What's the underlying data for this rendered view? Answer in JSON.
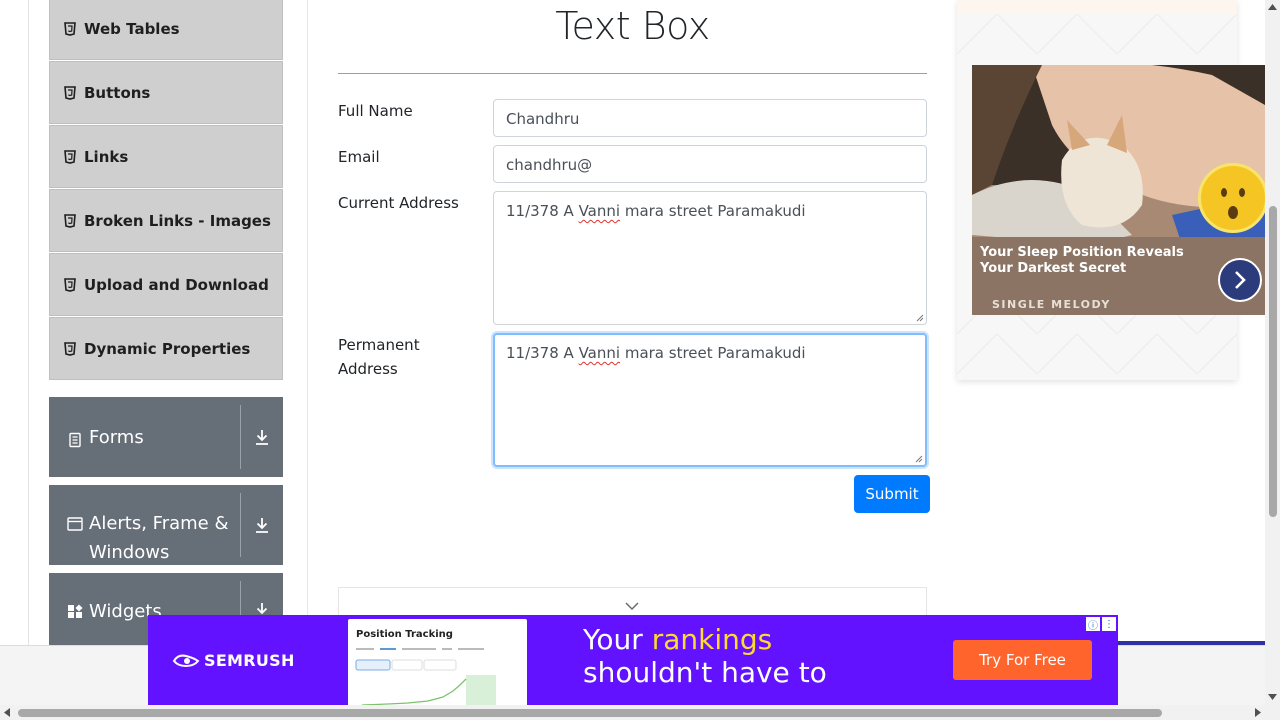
{
  "sidebar": {
    "items": [
      {
        "label": "Web Tables"
      },
      {
        "label": "Buttons"
      },
      {
        "label": "Links"
      },
      {
        "label": "Broken Links - Images"
      },
      {
        "label": "Upload and Download"
      },
      {
        "label": "Dynamic Properties"
      }
    ],
    "groups": [
      {
        "label": "Forms"
      },
      {
        "label": "Alerts, Frame & Windows"
      },
      {
        "label": "Widgets"
      }
    ]
  },
  "main": {
    "title": "Text Box",
    "form": {
      "full_name_label": "Full Name",
      "full_name_value": "Chandhru",
      "email_label": "Email",
      "email_value": "chandhru@",
      "current_address_label": "Current Address",
      "current_address_pre": "11/378 A ",
      "current_address_misspelled": "Vanni",
      "current_address_post": " mara street Paramakudi",
      "permanent_address_label": "Permanent Address",
      "permanent_address_pre": "11/378 A ",
      "permanent_address_misspelled": "Vanni",
      "permanent_address_post": " mara street Paramakudi",
      "submit_label": "Submit"
    }
  },
  "right_ad": {
    "caption": "Your Sleep Position Reveals Your Darkest Secret",
    "brand": "SINGLE MELODY"
  },
  "bottom_ad": {
    "brand": "SEMRUSH",
    "screenshot_title": "Position Tracking",
    "headline_pre": "Your ",
    "headline_highlight": "rankings",
    "headline_line2": "shouldn't have to",
    "cta": "Try For Free"
  },
  "colors": {
    "accent": "#007bff",
    "sidebar_group": "#666e78",
    "banner_purple": "#6212ff",
    "cta_orange": "#ff642d"
  }
}
